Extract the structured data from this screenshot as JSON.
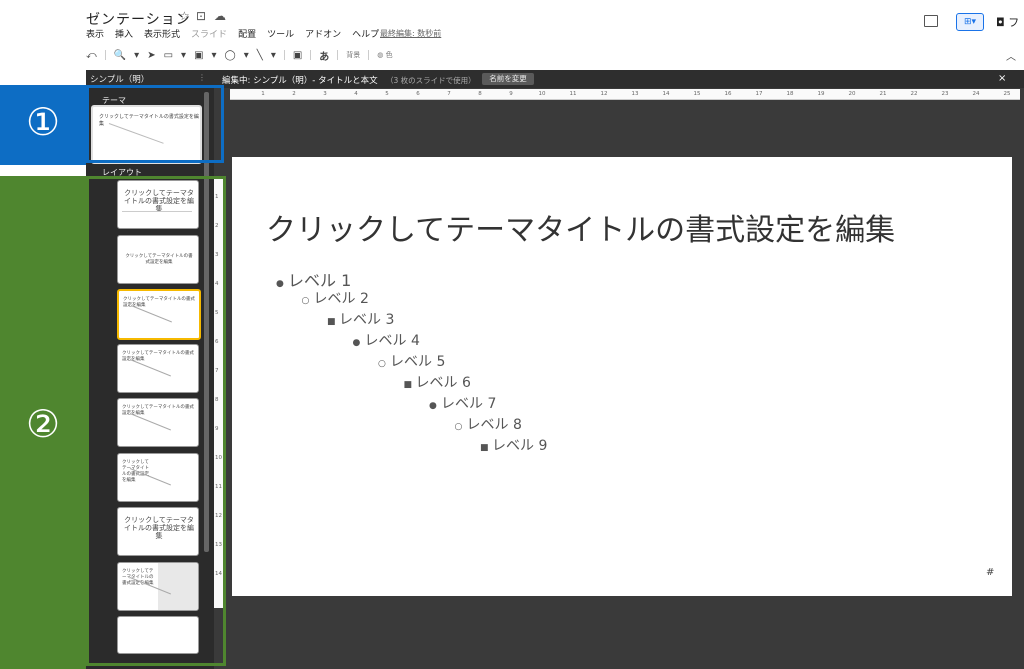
{
  "app": {
    "title": "ゼンテーション",
    "icons": [
      "star-icon",
      "folder-icon",
      "cloud-icon"
    ],
    "menu": [
      "表示",
      "挿入",
      "表示形式",
      "スライド",
      "配置",
      "ツール",
      "アドオン",
      "ヘルプ"
    ],
    "last_edit": "最終編集: 数秒前",
    "present_label": "⊞▾",
    "share_label": "◘ フ"
  },
  "toolbar": {
    "items": [
      "⤺",
      "🔍",
      "▾",
      "➤",
      "▭",
      "▾",
      "▣",
      "▾",
      "◯",
      "▾",
      "╲",
      "▾",
      "▣"
    ],
    "font_btn": "あ",
    "background_label": "背景",
    "color_label": "色"
  },
  "editbar": {
    "theme_name": "シンプル（明）",
    "dots": "⋮",
    "editing": "編集中: シンプル（明）- タイトルと本文",
    "usage": "（3 枚のスライドで使用）",
    "rename": "名前を変更",
    "close": "×"
  },
  "filmstrip": {
    "theme_header": "テーマ",
    "layout_header": "レイアウト",
    "theme_thumb_text": "クリックしてテーマタイトルの書式設定を編集",
    "layouts": [
      {
        "text": "クリックしてテーマタイトルの書式設定を編集",
        "big": true
      },
      {
        "text": "クリックしてテーマタイトルの書式設定を編集",
        "big": false
      },
      {
        "text": "クリックしてテーマタイトルの書式設定を編集",
        "big": false
      },
      {
        "text": "クリックしてテーマタイトルの書式設定を編集",
        "big": false
      },
      {
        "text": "クリックしてテーマタイトルの書式設定を編集",
        "big": false
      },
      {
        "text": "クリックしてテーマタイトルの書式設定を編集",
        "big": false
      },
      {
        "text": "クリックしてテーマタイトルの書式設定を編集",
        "big": true
      },
      {
        "text": "クリックしてテーマタイトルの書式設定を編集",
        "big": false
      },
      {
        "text": "",
        "big": false
      }
    ]
  },
  "ruler": {
    "numbers": [
      "1",
      "2",
      "3",
      "4",
      "5",
      "6",
      "7",
      "8",
      "9",
      "10",
      "11",
      "12",
      "13",
      "14",
      "15",
      "16",
      "17",
      "18",
      "19",
      "20",
      "21",
      "22",
      "23",
      "24",
      "25"
    ]
  },
  "vruler": {
    "numbers": [
      "1",
      "2",
      "3",
      "4",
      "5",
      "6",
      "7",
      "8",
      "9",
      "10",
      "11",
      "12",
      "13",
      "14"
    ]
  },
  "slide": {
    "title": "クリックしてテーマタイトルの書式設定を編集",
    "levels": [
      {
        "bullet": "●",
        "text": "レベル 1"
      },
      {
        "bullet": "○",
        "text": "レベル 2"
      },
      {
        "bullet": "■",
        "text": "レベル 3"
      },
      {
        "bullet": "●",
        "text": "レベル 4"
      },
      {
        "bullet": "○",
        "text": "レベル 5"
      },
      {
        "bullet": "■",
        "text": "レベル 6"
      },
      {
        "bullet": "●",
        "text": "レベル 7"
      },
      {
        "bullet": "○",
        "text": "レベル 8"
      },
      {
        "bullet": "■",
        "text": "レベル 9"
      }
    ],
    "page_number": "#"
  },
  "annotations": {
    "one": "①",
    "two": "②"
  },
  "colors": {
    "annotation_blue": "#0d6dc4",
    "annotation_green": "#4f862f",
    "selection": "#f6b900"
  }
}
